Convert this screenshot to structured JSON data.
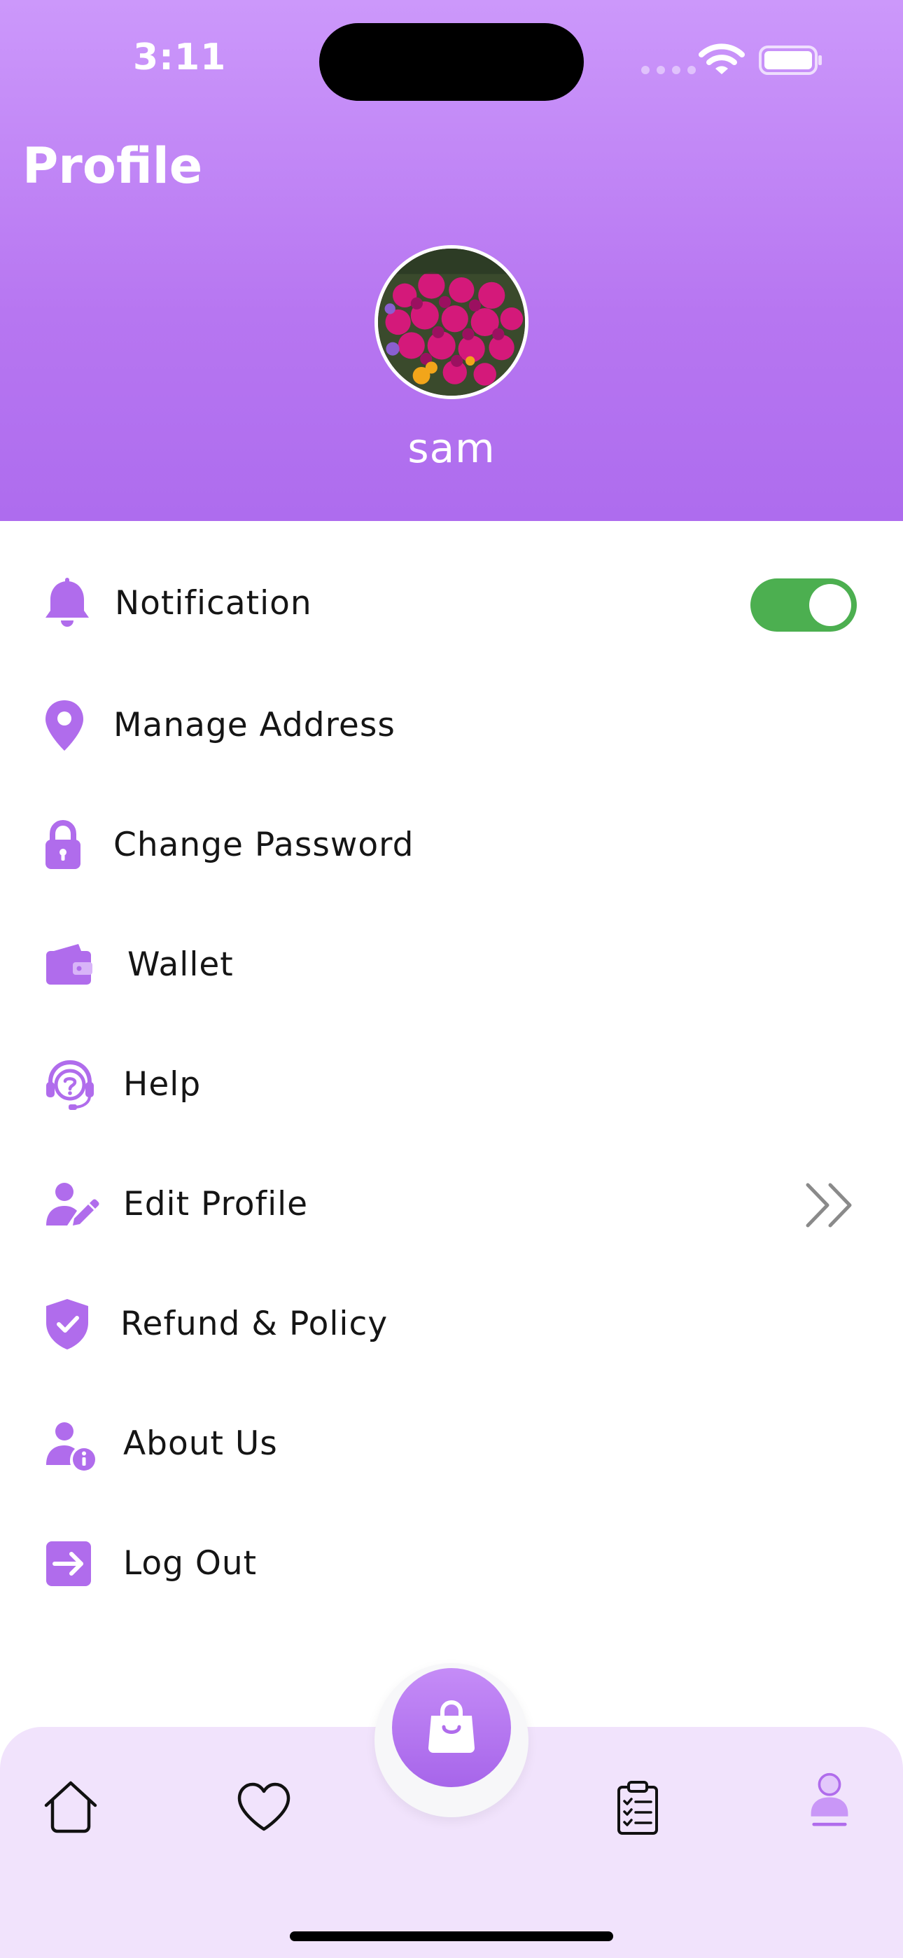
{
  "status_bar": {
    "time": "3:11"
  },
  "header": {
    "title": "Profile",
    "username": "sam"
  },
  "menu": [
    {
      "id": "notification",
      "label": "Notification",
      "icon": "bell-icon",
      "control": "toggle",
      "toggle_on": true
    },
    {
      "id": "manage-address",
      "label": "Manage Address",
      "icon": "location-pin-icon"
    },
    {
      "id": "change-password",
      "label": "Change Password",
      "icon": "lock-icon"
    },
    {
      "id": "wallet",
      "label": "Wallet",
      "icon": "wallet-icon"
    },
    {
      "id": "help",
      "label": "Help",
      "icon": "headset-help-icon"
    },
    {
      "id": "edit-profile",
      "label": "Edit Profile",
      "icon": "user-edit-icon",
      "control": "chevron"
    },
    {
      "id": "refund-policy",
      "label": "Refund & Policy",
      "icon": "shield-check-icon"
    },
    {
      "id": "about-us",
      "label": "About Us",
      "icon": "user-info-icon"
    },
    {
      "id": "log-out",
      "label": "Log Out",
      "icon": "logout-icon"
    }
  ],
  "bottom_nav": {
    "items": [
      {
        "id": "home",
        "icon": "home-icon"
      },
      {
        "id": "favorites",
        "icon": "heart-icon"
      },
      {
        "id": "cart",
        "icon": "shopping-bag-icon"
      },
      {
        "id": "orders",
        "icon": "clipboard-list-icon"
      },
      {
        "id": "profile",
        "icon": "profile-icon",
        "active": true
      }
    ]
  },
  "colors": {
    "accent": "#b06cec",
    "header_top": "#cc98fb",
    "header_bottom": "#ae6cee",
    "toggle_on": "#4caf50",
    "nav_background": "#f1e3fc"
  }
}
